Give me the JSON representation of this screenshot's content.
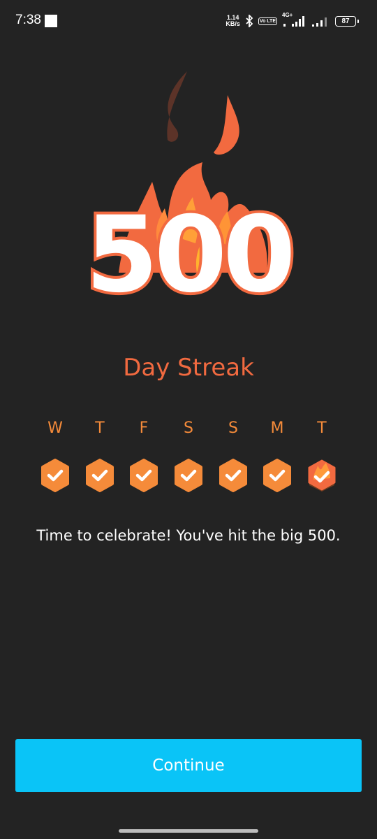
{
  "status_bar": {
    "time": "7:38",
    "speed_value": "1.14",
    "speed_unit": "KB/s",
    "volte": "Vo LTE",
    "network": "4G+",
    "battery": "87"
  },
  "streak": {
    "number": "500",
    "label": "Day Streak"
  },
  "week": {
    "days": [
      "W",
      "T",
      "F",
      "S",
      "S",
      "M",
      "T"
    ],
    "completed": [
      true,
      true,
      true,
      true,
      true,
      true,
      true
    ],
    "today_index": 6
  },
  "message": "Time to celebrate! You've hit the big 500.",
  "continue_label": "Continue",
  "colors": {
    "background": "#232323",
    "accent_orange": "#f26a40",
    "day_orange": "#f58b3a",
    "button_blue": "#0ac4f7"
  }
}
